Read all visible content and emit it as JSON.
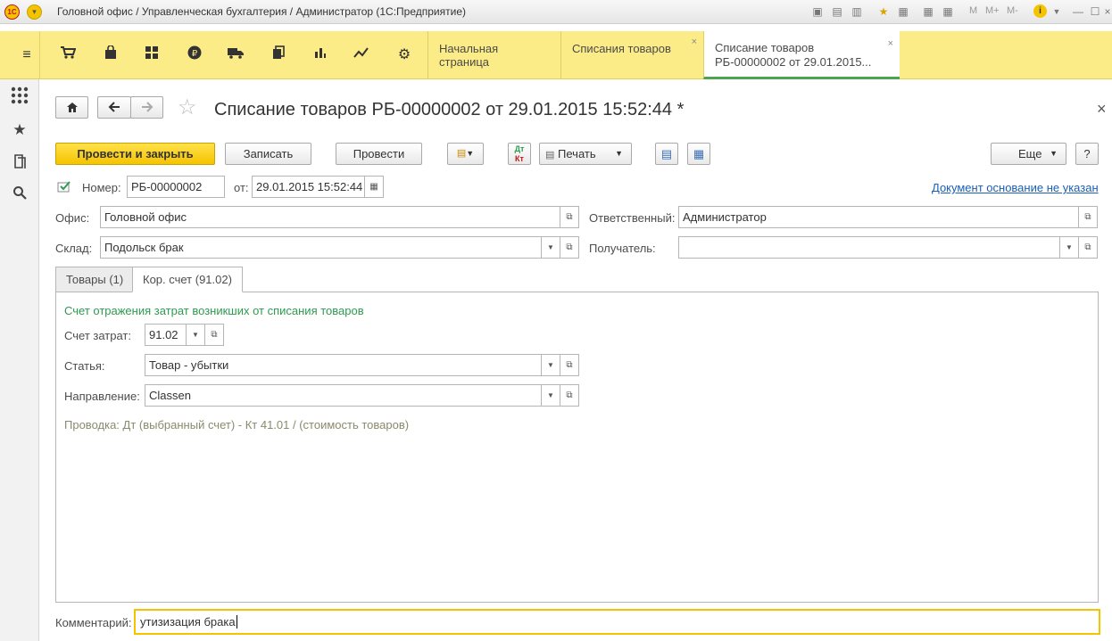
{
  "window": {
    "logo_text": "1С",
    "title": "Головной офис / Управленческая бухгалтерия / Администратор  (1С:Предприятие)",
    "memory_labels": [
      "M",
      "M+",
      "M-"
    ],
    "info_icon": "i"
  },
  "sections": [
    "menu-icon",
    "cart-icon",
    "bag-icon",
    "grid-icon",
    "ruble-icon",
    "truck-icon",
    "copy-icon",
    "bar-chart-icon",
    "trend-icon",
    "gear-icon"
  ],
  "tabs": [
    {
      "label": "Начальная страница",
      "active": false,
      "closable": false
    },
    {
      "label": "Списания товаров",
      "active": false,
      "closable": true
    },
    {
      "label_line1": "Списание товаров",
      "label_line2": "РБ-00000002 от 29.01.2015...",
      "active": true,
      "closable": true
    }
  ],
  "tab_close": "×",
  "left_panel": [
    "apps-icon",
    "star-icon",
    "history-icon",
    "search-icon"
  ],
  "document": {
    "title": "Списание товаров РБ-00000002 от 29.01.2015 15:52:44 *",
    "close": "×"
  },
  "toolbar": {
    "post_close": "Провести и закрыть",
    "save": "Записать",
    "post": "Провести",
    "print": "Печать",
    "more": "Еще",
    "help": "?"
  },
  "header_fields": {
    "number_label": "Номер:",
    "number_value": "РБ-00000002",
    "date_label": "от:",
    "date_value": "29.01.2015 15:52:44",
    "basis_link": "Документ основание не указан",
    "office_label": "Офис:",
    "office_value": "Головной офис",
    "responsible_label": "Ответственный:",
    "responsible_value": "Администратор",
    "warehouse_label": "Склад:",
    "warehouse_value": "Подольск брак",
    "recipient_label": "Получатель:",
    "recipient_value": ""
  },
  "form_tabs": [
    {
      "label": "Товары (1)",
      "active": false
    },
    {
      "label": "Кор. счет (91.02)",
      "active": true
    }
  ],
  "tab_page": {
    "heading": "Счет отражения затрат возникших от списания товаров",
    "account_label": "Счет затрат:",
    "account_value": "91.02",
    "article_label": "Статья:",
    "article_value": "Товар - убытки",
    "direction_label": "Направление:",
    "direction_value": "Classen",
    "posting_text": "Проводка: Дт (выбранный счет) - Кт 41.01  / (стоимость товаров)"
  },
  "comment": {
    "label": "Комментарий:",
    "value": "утизизация брака"
  }
}
